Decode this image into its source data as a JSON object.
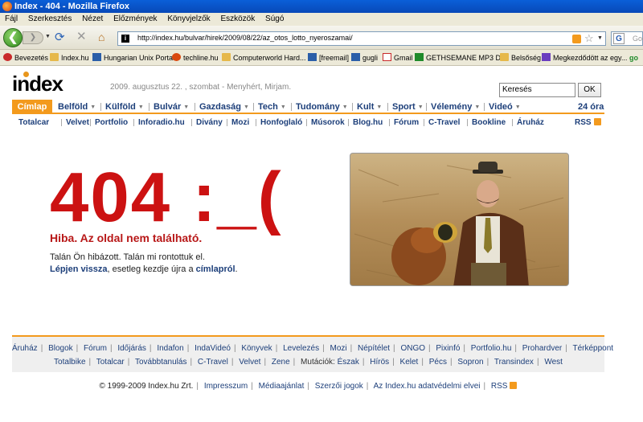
{
  "window": {
    "title": "Index - 404 - Mozilla Firefox"
  },
  "menu": [
    "Fájl",
    "Szerkesztés",
    "Nézet",
    "Előzmények",
    "Könyvjelzők",
    "Eszközök",
    "Súgó"
  ],
  "address": {
    "url": "http://index.hu/bulvar/hirek/2009/08/22/az_otos_lotto_nyeroszamai/",
    "search_placeholder": "Goo"
  },
  "bookmarks": [
    "Bevezetés",
    "Index.hu",
    "Hungarian Unix Portal",
    "techline.hu",
    "Computerworld Hard...",
    "[freemail]",
    "gugli",
    "Gmail",
    "GETHSEMANE MP3 D...",
    "Belsőség",
    "Megkezdődött az egy...",
    "go"
  ],
  "site": {
    "logo": "index",
    "date_line": "2009. augusztus 22. , szombat - Menyhért, Mirjam.",
    "search_value": "Keresés",
    "ok_label": "OK"
  },
  "nav": {
    "home": "Címlap",
    "items": [
      "Belföld",
      "Külföld",
      "Bulvár",
      "Gazdaság",
      "Tech",
      "Tudomány",
      "Kult",
      "Sport",
      "Vélemény",
      "Videó"
    ],
    "right": "24 óra"
  },
  "subnav": {
    "items": [
      "Totalcar",
      "Velvet",
      "Portfolio",
      "Inforadio.hu",
      "Divány",
      "Mozi",
      "Honfoglaló",
      "Músorok",
      "Blog.hu",
      "Fórum",
      "C-Travel",
      "Bookline",
      "Áruház"
    ],
    "rss": "RSS"
  },
  "error": {
    "code": "404 :_(",
    "title": "Hiba. Az oldal nem található.",
    "line1": "Talán Ön hibázott. Talán mi rontottuk el.",
    "line2_link1": "Lépjen vissza",
    "line2_middle": ", esetleg kezdje újra a ",
    "line2_link2": "címlapról",
    "line2_end": "."
  },
  "footer": {
    "row1": [
      "Áruház",
      "Blogok",
      "Fórum",
      "Időjárás",
      "Indafon",
      "IndaVideó",
      "Könyvek",
      "Levelezés",
      "Mozi",
      "Népítélet",
      "ONGO",
      "Pixinfó",
      "Portfolio.hu",
      "Prohardver",
      "Térképpont"
    ],
    "row2a": [
      "Totalbike",
      "Totalcar",
      "Továbbtanulás",
      "C-Travel",
      "Velvet",
      "Zene"
    ],
    "row2_label": "Mutációk:",
    "row2b": [
      "Észak",
      "Hírös",
      "Kelet",
      "Pécs",
      "Sopron",
      "Transindex",
      "West"
    ]
  },
  "copyright": {
    "text": "© 1999-2009 Index.hu Zrt.",
    "links": [
      "Impresszum",
      "Médiaajánlat",
      "Szerzői jogok",
      "Az Index.hu adatvédelmi elvei",
      "RSS"
    ]
  },
  "colors": {
    "accent": "#f39a1d",
    "link": "#1d3f7a",
    "error": "#cc1212"
  }
}
